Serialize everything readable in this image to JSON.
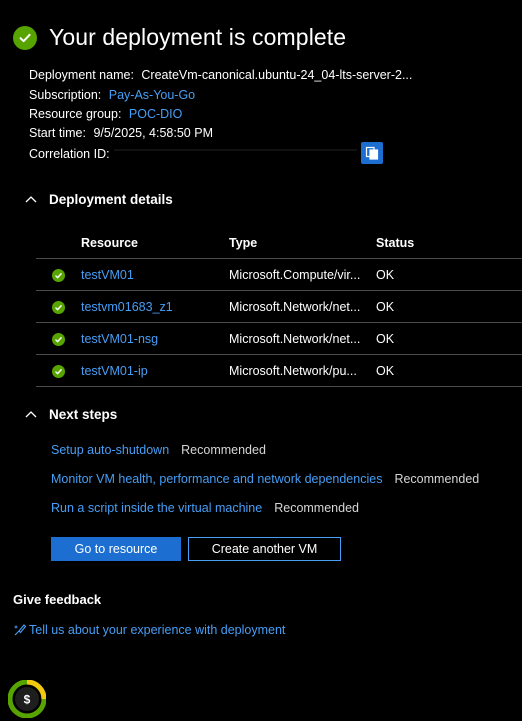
{
  "header": {
    "title": "Your deployment is complete"
  },
  "info": {
    "deployment_name_label": "Deployment name:",
    "deployment_name_value": "CreateVm-canonical.ubuntu-24_04-lts-server-2...",
    "subscription_label": "Subscription:",
    "subscription_value": "Pay-As-You-Go",
    "resource_group_label": "Resource group:",
    "resource_group_value": "POC-DIO",
    "start_time_label": "Start time:",
    "start_time_value": "9/5/2025, 4:58:50 PM",
    "correlation_label": "Correlation ID:"
  },
  "deployment_details": {
    "heading": "Deployment details",
    "columns": [
      "Resource",
      "Type",
      "Status"
    ],
    "rows": [
      {
        "resource": "testVM01",
        "type": "Microsoft.Compute/vir...",
        "status": "OK"
      },
      {
        "resource": "testvm01683_z1",
        "type": "Microsoft.Network/net...",
        "status": "OK"
      },
      {
        "resource": "testVM01-nsg",
        "type": "Microsoft.Network/net...",
        "status": "OK"
      },
      {
        "resource": "testVM01-ip",
        "type": "Microsoft.Network/pu...",
        "status": "OK"
      }
    ]
  },
  "next_steps": {
    "heading": "Next steps",
    "items": [
      {
        "link": "Setup auto-shutdown",
        "tag": "Recommended"
      },
      {
        "link": "Monitor VM health, performance and network dependencies",
        "tag": "Recommended"
      },
      {
        "link": "Run a script inside the virtual machine",
        "tag": "Recommended"
      }
    ]
  },
  "buttons": {
    "go_to_resource": "Go to resource",
    "create_another": "Create another VM"
  },
  "feedback": {
    "heading": "Give feedback",
    "link": "Tell us about your experience with deployment"
  },
  "cost_icon_symbol": "$",
  "colors": {
    "success": "#57a300",
    "link": "#479ef5",
    "primary_button": "#1c6fd1"
  }
}
